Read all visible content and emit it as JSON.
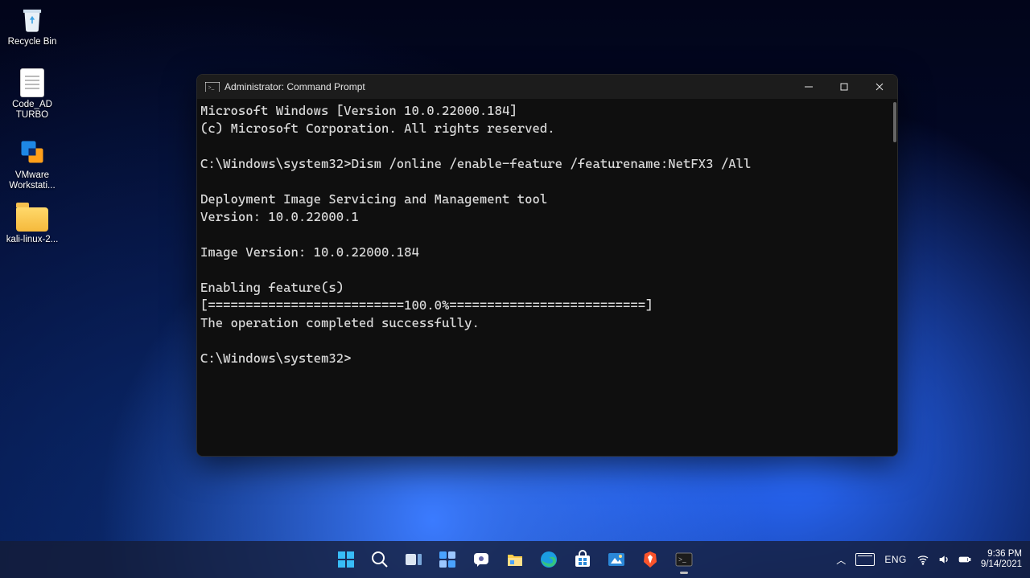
{
  "desktop": {
    "icons": [
      {
        "name": "recycle-bin",
        "label": "Recycle Bin"
      },
      {
        "name": "code-ad-turbo",
        "label": "Code_AD TURBO"
      },
      {
        "name": "vmware",
        "label": "VMware Workstati..."
      },
      {
        "name": "kali-folder",
        "label": "kali-linux-2..."
      }
    ]
  },
  "cmd_window": {
    "title": "Administrator: Command Prompt",
    "lines": [
      "Microsoft Windows [Version 10.0.22000.184]",
      "(c) Microsoft Corporation. All rights reserved.",
      "",
      "C:\\Windows\\system32>Dism /online /enable-feature /featurename:NetFX3 /All",
      "",
      "Deployment Image Servicing and Management tool",
      "Version: 10.0.22000.1",
      "",
      "Image Version: 10.0.22000.184",
      "",
      "Enabling feature(s)",
      "[==========================100.0%==========================]",
      "The operation completed successfully.",
      "",
      "C:\\Windows\\system32>"
    ]
  },
  "taskbar": {
    "center_items": [
      {
        "name": "start",
        "tip": "Start"
      },
      {
        "name": "search",
        "tip": "Search"
      },
      {
        "name": "taskview",
        "tip": "Task View"
      },
      {
        "name": "widgets",
        "tip": "Widgets"
      },
      {
        "name": "chat",
        "tip": "Chat"
      },
      {
        "name": "explorer",
        "tip": "File Explorer"
      },
      {
        "name": "edge",
        "tip": "Microsoft Edge"
      },
      {
        "name": "store",
        "tip": "Microsoft Store"
      },
      {
        "name": "photos",
        "tip": "Photos"
      },
      {
        "name": "brave",
        "tip": "Brave"
      },
      {
        "name": "cmd",
        "tip": "Command Prompt",
        "active": true
      }
    ],
    "tray": {
      "overflow": "^",
      "language": "ENG",
      "time": "9:36 PM",
      "date": "9/14/2021"
    }
  }
}
